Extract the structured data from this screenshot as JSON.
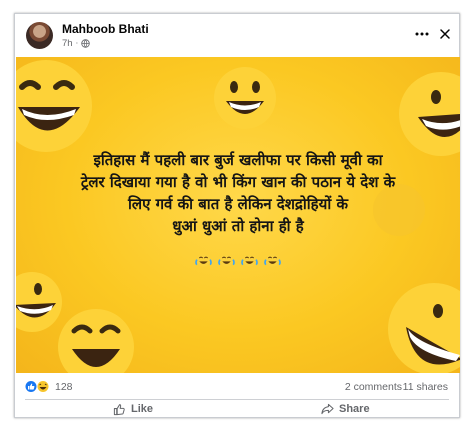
{
  "post": {
    "author": "Mahboob Bhati",
    "time": "7h",
    "separator": "·",
    "audience_icon": "globe-icon",
    "more_icon": "more-horizontal-icon",
    "close_icon": "close-icon"
  },
  "meme": {
    "caption": "इतिहास मैं पहली बार बुर्ज खलीफा पर किसी मूवी का\nट्रेलर दिखाया गया है वो भी किंग खान की पठान ये देश के\nलिए गर्व की बात है लेकिन देशद्रोहियों के\nधुआं धुआं तो होना ही है",
    "laugh_emoji_count": 4,
    "background_color": "#fbc822"
  },
  "reactions": {
    "icons": [
      "like-reaction-icon",
      "haha-reaction-icon"
    ],
    "count": "128",
    "comments": "2 comments",
    "shares": "11 shares"
  },
  "actions": {
    "like_label": "Like",
    "share_label": "Share"
  },
  "colors": {
    "facebook_blue": "#1877f2",
    "secondary_text": "#65676b",
    "emoji_yellow": "#fcd23c"
  }
}
